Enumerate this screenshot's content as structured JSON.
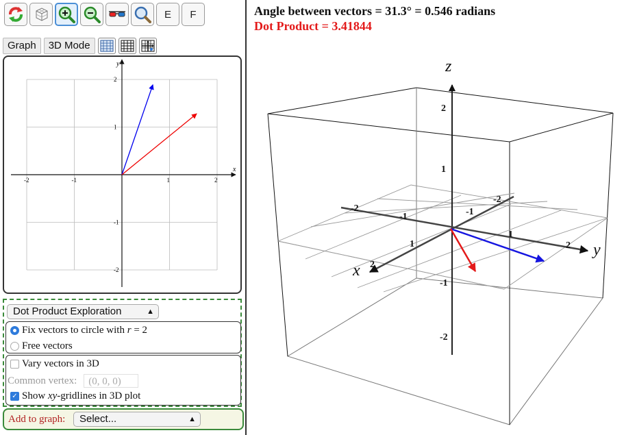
{
  "toolbar": {
    "buttons": [
      {
        "name": "reset",
        "icon": "reset-icon"
      },
      {
        "name": "3d-view",
        "icon": "cube-grid-icon"
      },
      {
        "name": "zoom-in",
        "icon": "zoom-in-icon",
        "active": true
      },
      {
        "name": "zoom-out",
        "icon": "zoom-out-icon"
      },
      {
        "name": "anaglyph",
        "icon": "3d-glasses-icon"
      },
      {
        "name": "zoom-fit",
        "icon": "magnifier-icon"
      },
      {
        "name": "e",
        "label": "E"
      },
      {
        "name": "f",
        "label": "F"
      }
    ],
    "e_label": "E",
    "f_label": "F"
  },
  "mode_tabs": {
    "graph": "Graph",
    "mode3d": "3D Mode"
  },
  "graph2d": {
    "x_label": "x",
    "y_label": "y",
    "x_ticks": [
      "-2",
      "-1",
      "1",
      "2"
    ],
    "y_ticks": [
      "2",
      "1",
      "-1",
      "-2"
    ],
    "vectors": [
      {
        "color": "#0000ee",
        "x": 0.65,
        "y": 1.89
      },
      {
        "color": "#ee0000",
        "x": 1.57,
        "y": 1.28
      }
    ]
  },
  "controls": {
    "exploration_select": "Dot Product Exploration",
    "fix_vectors_prefix": "Fix vectors to circle with ",
    "fix_vectors_var": "r",
    "fix_vectors_suffix": " = 2",
    "free_vectors": "Free vectors",
    "vary_3d": "Vary vectors in 3D",
    "common_vertex_label": "Common vertex:",
    "common_vertex_value": "(0, 0, 0)",
    "show_grid_prefix": "Show ",
    "show_grid_var": "xy",
    "show_grid_suffix": "-gridlines in 3D plot",
    "fix_selected": true,
    "vary_checked": false,
    "grid_checked": true
  },
  "add_to_graph": {
    "label": "Add to graph:",
    "select": "Select..."
  },
  "result": {
    "angle_text": "Angle between vectors  =  31.3°  =  0.546 radians",
    "dot_text": "Dot Product  =  3.41844",
    "angle_color": "#111111",
    "dot_color": "#e31a1a"
  },
  "plot3d": {
    "x_label": "x",
    "y_label": "y",
    "z_label": "z",
    "z_ticks": [
      "2",
      "1",
      "-1",
      "-2"
    ],
    "x_ticks": [
      "-2",
      "-1",
      "1",
      "2"
    ],
    "y_ticks": [
      "-2",
      "-1",
      "1",
      "2"
    ]
  }
}
